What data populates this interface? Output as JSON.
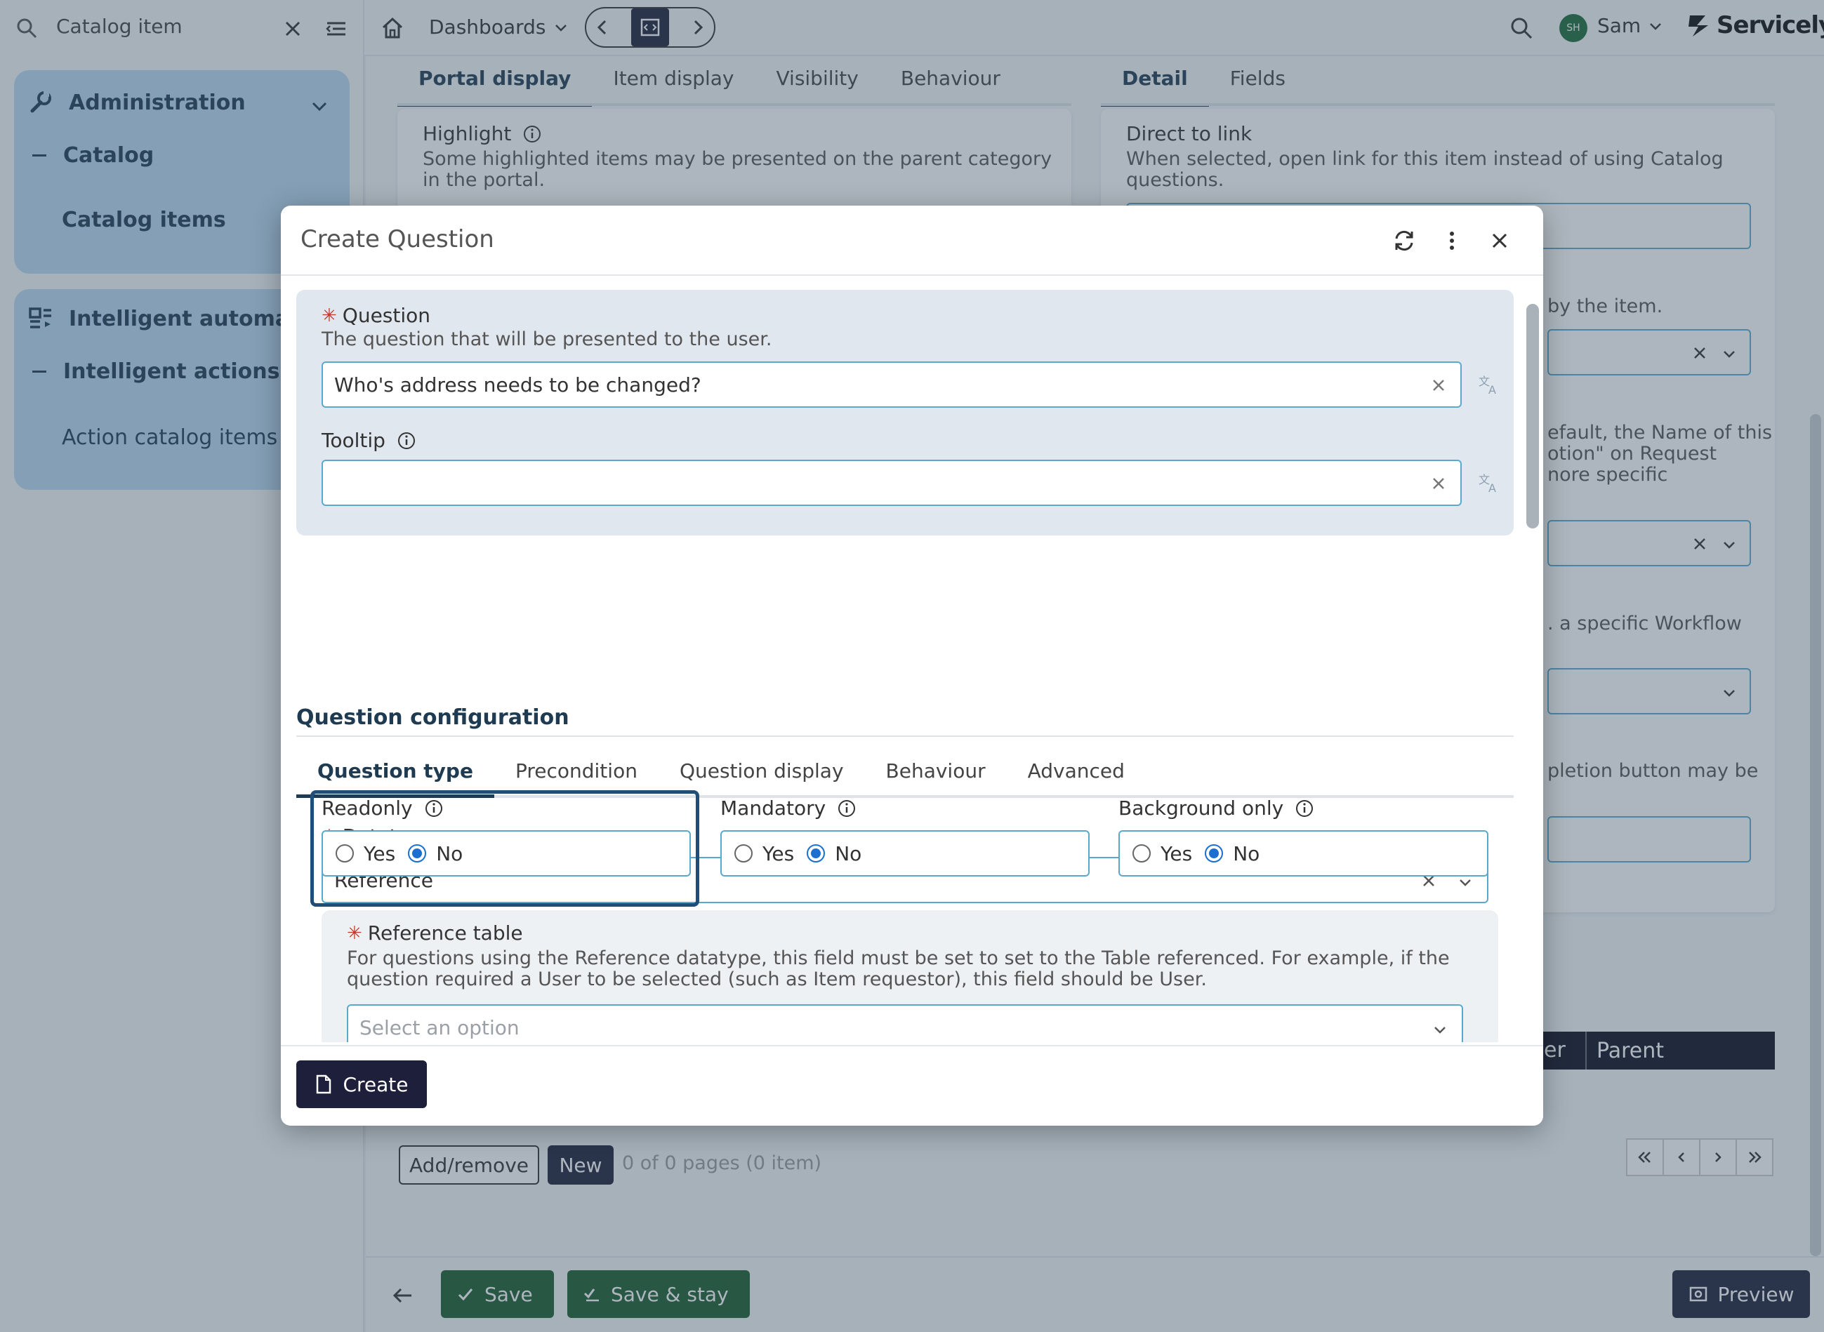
{
  "search": {
    "value": "Catalog item"
  },
  "sidebar": {
    "admin_title": "Administration",
    "catalog_label": "Catalog",
    "catalog_items_label": "Catalog items",
    "intelligent_title": "Intelligent automatio",
    "intelligent_actions_label": "Intelligent actions",
    "action_catalog_label": "Action catalog items"
  },
  "topbar": {
    "dashboards_label": "Dashboards",
    "user_initials": "SH",
    "user_name": "Sam",
    "brand": "Servicely"
  },
  "background": {
    "left_tabs": [
      "Portal display",
      "Item display",
      "Visibility",
      "Behaviour"
    ],
    "right_tabs": [
      "Detail",
      "Fields"
    ],
    "highlight_label": "Highlight",
    "highlight_desc": "Some highlighted items may be presented on the parent category in the portal.",
    "direct_link_label": "Direct to link",
    "direct_link_desc": "When selected, open link for this item instead of using Catalog questions.",
    "frag1": "by the item.",
    "frag2": "efault, the Name of this",
    "frag3": "otion\" on Request",
    "frag4": "nore specific",
    "frag5": ". a specific Workflow",
    "frag6": "pletion button may be",
    "table_headers": [
      "der",
      "Parent"
    ],
    "add_remove_label": "Add/remove",
    "new_label": "New",
    "paging_text": "0 of 0 pages (0 item)",
    "save_label": "Save",
    "save_stay_label": "Save & stay",
    "preview_label": "Preview"
  },
  "modal": {
    "title": "Create Question",
    "question_label": "Question",
    "question_desc": "The question that will be presented to the user.",
    "question_value": "Who's address needs to be changed?",
    "tooltip_label": "Tooltip",
    "tooltip_value": "",
    "section_title": "Question configuration",
    "tabs": [
      "Question type",
      "Precondition",
      "Question display",
      "Behaviour",
      "Advanced"
    ],
    "datatype_label": "Datatype",
    "datatype_value": "Reference",
    "readonly_label": "Readonly",
    "mandatory_label": "Mandatory",
    "background_only_label": "Background only",
    "yes_label": "Yes",
    "no_label": "No",
    "readonly_value": "No",
    "mandatory_value": "No",
    "background_only_value": "No",
    "reference_table_label": "Reference table",
    "reference_table_desc_1": "For questions using the Reference datatype, this field must be set to set to the Table referenced. For example, if the",
    "reference_table_desc_2": "question required a User to be selected (such as Item requestor), this field should be User.",
    "reference_table_placeholder": "Select an option",
    "create_label": "Create"
  },
  "colors": {
    "sidebar_card": "#b8d8f1",
    "primary_dark": "#1e1f3a",
    "save_green": "#1a5c2e",
    "input_border": "#5aa9cc",
    "required_red": "#c0392b",
    "radio_blue": "#1b6fd0"
  }
}
